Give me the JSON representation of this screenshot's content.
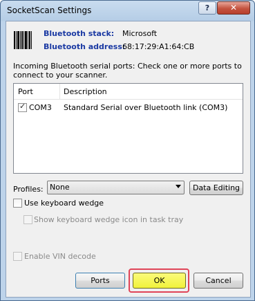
{
  "window": {
    "title": "SocketScan Settings",
    "help_glyph": "?",
    "close_glyph": "✕"
  },
  "info": {
    "stack_label": "Bluetooth stack:",
    "stack_value": "Microsoft",
    "address_label": "Bluetooth address:",
    "address_value": "68:17:29:A1:64:CB"
  },
  "description": "Incoming Bluetooth serial ports: Check one or more ports to connect to your scanner.",
  "ports": {
    "columns": [
      "Port",
      "Description"
    ],
    "rows": [
      {
        "port": "COM3",
        "description": "Standard Serial over Bluetooth link (COM3)",
        "checked": true
      }
    ]
  },
  "profiles": {
    "label": "Profiles:",
    "selected": "None",
    "data_editing_label": "Data Editing"
  },
  "options": {
    "keyboard_wedge_label": "Use keyboard wedge",
    "keyboard_wedge_checked": false,
    "tray_icon_label": "Show keyboard wedge icon in task tray",
    "tray_icon_enabled": false,
    "vin_label": "Enable VIN decode",
    "vin_enabled": false
  },
  "buttons": {
    "ports": "Ports",
    "ok": "OK",
    "cancel": "Cancel"
  },
  "colors": {
    "label_blue": "#1b3aa3",
    "ok_highlight": "#e04458",
    "ok_fill": "#f1f23a"
  }
}
